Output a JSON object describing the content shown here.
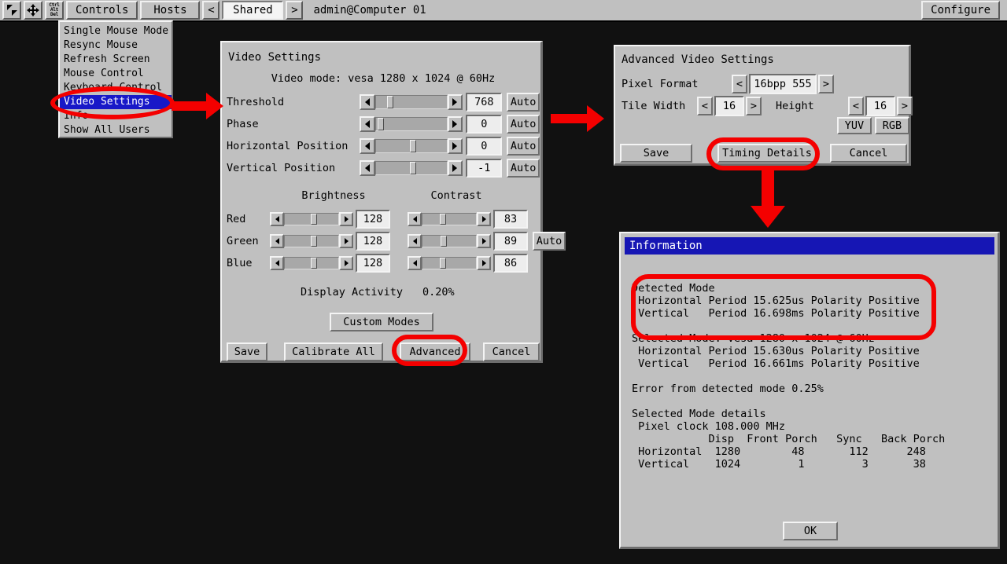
{
  "toolbar": {
    "icons": [
      {
        "name": "pointer-icon",
        "label": ""
      },
      {
        "name": "move-icon",
        "label": ""
      },
      {
        "name": "ctrl-alt-del-icon",
        "label": "Ctrl\nAlt\nDel"
      }
    ],
    "controls_label": "Controls",
    "hosts_label": "Hosts",
    "prev_label": "<",
    "shared_label": "Shared",
    "next_label": ">",
    "user_label": "admin@Computer 01",
    "configure_label": "Configure"
  },
  "menu": {
    "items": [
      {
        "label": "Single Mouse Mode",
        "selected": false
      },
      {
        "label": "Resync Mouse",
        "selected": false
      },
      {
        "label": "Refresh Screen",
        "selected": false
      },
      {
        "label": "Mouse Control",
        "selected": false
      },
      {
        "label": "Keyboard Control",
        "selected": false
      },
      {
        "label": "Video Settings",
        "selected": true
      },
      {
        "label": "Info",
        "selected": false
      },
      {
        "label": "Show All Users",
        "selected": false
      }
    ]
  },
  "video_settings": {
    "title": "Video Settings",
    "mode_line": "Video mode: vesa 1280 x 1024 @ 60Hz",
    "sliders": [
      {
        "label": "Threshold",
        "value": "768",
        "auto": "Auto",
        "pos": 16
      },
      {
        "label": "Phase",
        "value": "0",
        "auto": "Auto",
        "pos": 2
      },
      {
        "label": "Horizontal Position",
        "value": "0",
        "auto": "Auto",
        "pos": 48
      },
      {
        "label": "Vertical Position",
        "value": "-1",
        "auto": "Auto",
        "pos": 48
      }
    ],
    "brightness_header": "Brightness",
    "contrast_header": "Contrast",
    "channels": [
      {
        "label": "Red",
        "brightness": "128",
        "bpos": 48,
        "contrast": "83",
        "cpos": 32
      },
      {
        "label": "Green",
        "brightness": "128",
        "bpos": 48,
        "contrast": "89",
        "cpos": 34
      },
      {
        "label": "Blue",
        "brightness": "128",
        "bpos": 48,
        "contrast": "86",
        "cpos": 33
      }
    ],
    "channels_auto": "Auto",
    "display_activity_label": "Display Activity",
    "display_activity_value": "0.20%",
    "custom_modes_label": "Custom Modes",
    "save_label": "Save",
    "calibrate_label": "Calibrate All",
    "advanced_label": "Advanced",
    "cancel_label": "Cancel"
  },
  "advanced_settings": {
    "title": "Advanced Video Settings",
    "pixel_format_label": "Pixel Format",
    "pixel_format_value": "16bpp 555",
    "tile_width_label": "Tile Width",
    "tile_width_value": "16",
    "height_label": "Height",
    "height_value": "16",
    "yuv_label": "YUV",
    "rgb_label": "RGB",
    "save_label": "Save",
    "timing_details_label": "Timing Details",
    "cancel_label": "Cancel",
    "prev_arrow": "<",
    "next_arrow": ">"
  },
  "information": {
    "title": "Information",
    "body": "Detected Mode\n Horizontal Period 15.625us Polarity Positive\n Vertical   Period 16.698ms Polarity Positive\n\nSelected Mode: vesa 1280 x 1024 @ 60Hz\n Horizontal Period 15.630us Polarity Positive\n Vertical   Period 16.661ms Polarity Positive\n\nError from detected mode 0.25%\n\nSelected Mode details\n Pixel clock 108.000 MHz\n            Disp  Front Porch   Sync   Back Porch\n Horizontal  1280        48       112      248\n Vertical    1024         1         3       38",
    "detected_mode_heading": "Detected Mode",
    "detected_horizontal": " Horizontal Period 15.625us Polarity Positive",
    "detected_vertical": " Vertical   Period 16.698ms Polarity Positive",
    "selected_mode": "Selected Mode: vesa 1280 x 1024 @ 60Hz",
    "selected_horizontal": " Horizontal Period 15.630us Polarity Positive",
    "selected_vertical": " Vertical   Period 16.661ms Polarity Positive",
    "error_line": "Error from detected mode 0.25%",
    "details_heading": "Selected Mode details",
    "pixel_clock": " Pixel clock 108.000 MHz",
    "table_headers": [
      "",
      "Disp",
      "Front Porch",
      "Sync",
      "Back Porch"
    ],
    "table_rows": [
      [
        "Horizontal",
        "1280",
        "48",
        "112",
        "248"
      ],
      [
        "Vertical",
        "1024",
        "1",
        "3",
        "38"
      ]
    ],
    "ok_label": "OK"
  },
  "annotations": {
    "highlight_color": "#f40000",
    "targets": [
      "video-settings-menu-item",
      "advanced-button",
      "timing-details-button",
      "detected-mode-block"
    ]
  }
}
